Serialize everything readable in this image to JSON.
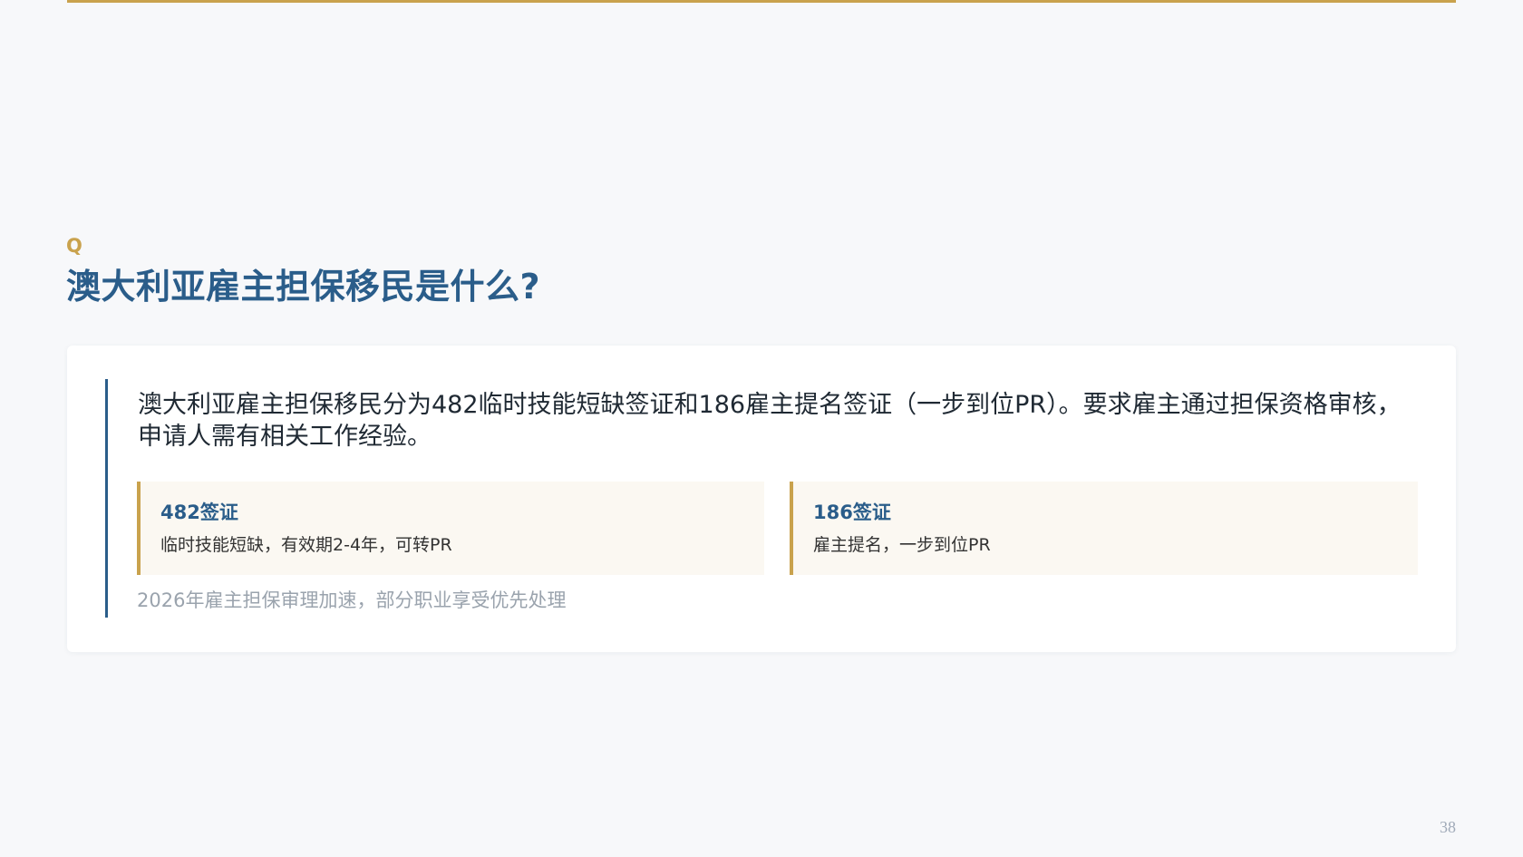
{
  "slide": {
    "q_marker": "Q",
    "title": "澳大利亚雇主担保移民是什么?",
    "answer": {
      "lead": "澳大利亚雇主担保移民分为482临时技能短缺签证和186雇主提名签证（一步到位PR）。要求雇主通过担保资格审核，申请人需有相关工作经验。",
      "visas": [
        {
          "title": "482签证",
          "description": "临时技能短缺，有效期2-4年，可转PR"
        },
        {
          "title": "186签证",
          "description": "雇主提名，一步到位PR"
        }
      ],
      "note": "2026年雇主担保审理加速，部分职业享受优先处理"
    },
    "page_number": "38"
  },
  "colors": {
    "accent_gold": "#c9a24d",
    "title_blue": "#2a5d8a",
    "background": "#f7f8fa"
  }
}
